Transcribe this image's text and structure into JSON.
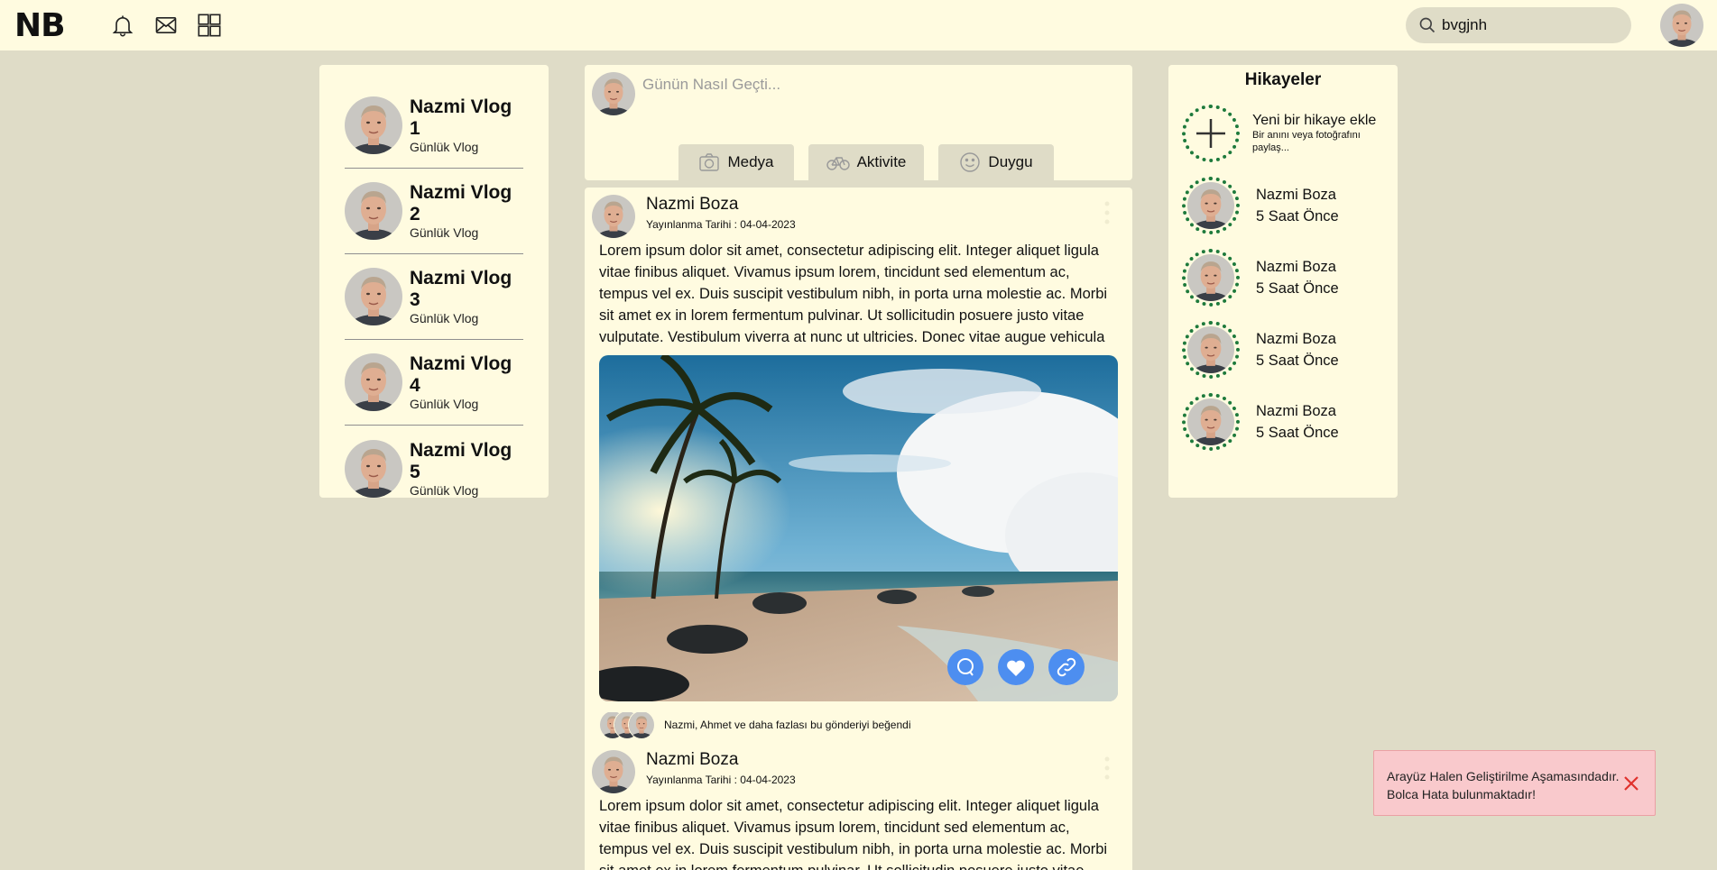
{
  "app": {
    "logo": "NB"
  },
  "header": {
    "search_value": "bvgjnh",
    "icons": [
      "bell-icon",
      "mail-icon",
      "grid-icon",
      "search-icon"
    ]
  },
  "left_panel": {
    "vlogs": [
      {
        "title": "Nazmi Vlog 1",
        "subtitle": "Günlük Vlog"
      },
      {
        "title": "Nazmi Vlog 2",
        "subtitle": "Günlük Vlog"
      },
      {
        "title": "Nazmi Vlog 3",
        "subtitle": "Günlük Vlog"
      },
      {
        "title": "Nazmi Vlog 4",
        "subtitle": "Günlük Vlog"
      },
      {
        "title": "Nazmi Vlog 5",
        "subtitle": "Günlük Vlog"
      }
    ]
  },
  "composer": {
    "placeholder": "Günün Nasıl Geçti...",
    "buttons": [
      {
        "label": "Medya",
        "icon": "camera-icon"
      },
      {
        "label": "Aktivite",
        "icon": "bicycle-icon"
      },
      {
        "label": "Duygu",
        "icon": "smile-icon"
      }
    ]
  },
  "posts": [
    {
      "author": "Nazmi Boza",
      "date": "Yayınlanma Tarihi : 04-04-2023",
      "text": "Lorem ipsum dolor sit amet, consectetur adipiscing elit. Integer aliquet ligula vitae finibus aliquet. Vivamus ipsum lorem, tincidunt sed elementum ac, tempus vel ex. Duis suscipit vestibulum nibh, in porta urna molestie ac. Morbi sit amet ex in lorem fermentum pulvinar. Ut sollicitudin posuere justo vitae vulputate. Vestibulum viverra at nunc ut ultricies. Donec vitae augue vehicula",
      "likes_text": "Nazmi, Ahmet ve daha fazlası bu gönderiyi beğendi",
      "actions": [
        "comment-icon",
        "heart-icon",
        "link-icon"
      ]
    },
    {
      "author": "Nazmi Boza",
      "date": "Yayınlanma Tarihi : 04-04-2023",
      "text": "Lorem ipsum dolor sit amet, consectetur adipiscing elit. Integer aliquet ligula vitae finibus aliquet. Vivamus ipsum lorem, tincidunt sed elementum ac, tempus vel ex. Duis suscipit vestibulum nibh, in porta urna molestie ac. Morbi sit amet ex in lorem fermentum pulvinar. Ut sollicitudin posuere justo vitae vulputate."
    }
  ],
  "stories": {
    "title": "Hikayeler",
    "add": {
      "title": "Yeni bir hikaye ekle",
      "subtitle": "Bir anını veya fotoğrafını paylaş..."
    },
    "items": [
      {
        "name": "Nazmi Boza",
        "time": "5 Saat Önce"
      },
      {
        "name": "Nazmi Boza",
        "time": "5 Saat Önce"
      },
      {
        "name": "Nazmi Boza",
        "time": "5 Saat Önce"
      },
      {
        "name": "Nazmi Boza",
        "time": "5 Saat Önce"
      }
    ]
  },
  "toast": {
    "line1": "Arayüz Halen Geliştirilme Aşamasındadır.",
    "line2": "Bolca Hata bulunmaktadır!"
  },
  "colors": {
    "background": "#dfdcc7",
    "panel": "#fffbe0",
    "accent_blue": "#4d8ef0",
    "story_ring": "#1e7a3c",
    "toast_bg": "#f9c9cc",
    "toast_close": "#e0322d"
  }
}
